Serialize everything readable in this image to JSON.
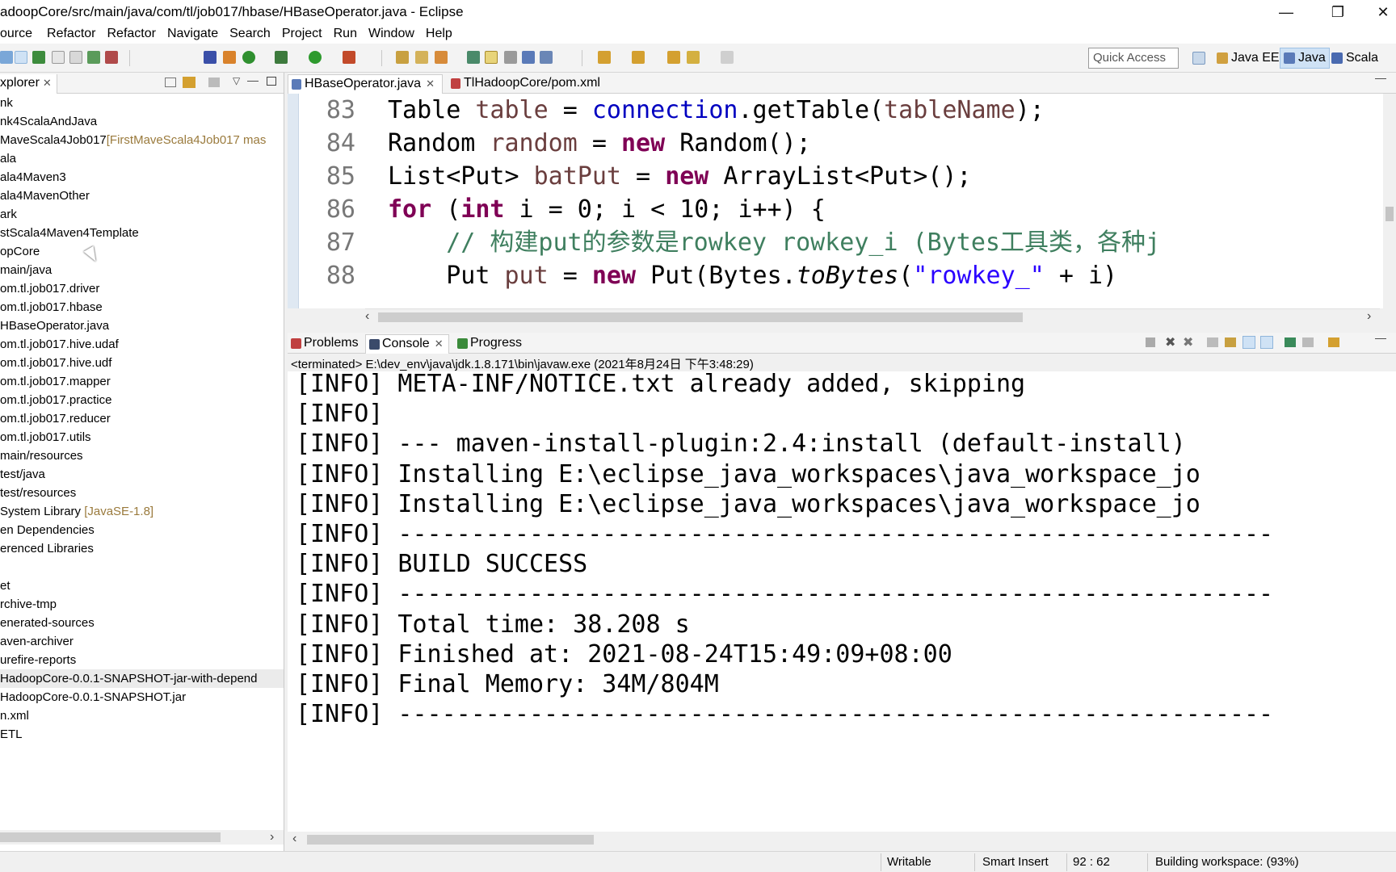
{
  "window": {
    "title": "adoopCore/src/main/java/com/tl/job017/hbase/HBaseOperator.java - Eclipse",
    "controls": [
      "—",
      "❐",
      "✕"
    ]
  },
  "menu": [
    "ource",
    "Refactor",
    "Refactor",
    "Navigate",
    "Search",
    "Project",
    "Run",
    "Window",
    "Help"
  ],
  "toolbar": {
    "quick_access": "Quick Access",
    "perspectives": [
      "Java EE",
      "Java",
      "Scala"
    ]
  },
  "explorer": {
    "tab": "xplorer",
    "items": [
      {
        "label": "nk",
        "dec": ""
      },
      {
        "label": "nk4ScalaAndJava",
        "dec": ""
      },
      {
        "label": "MaveScala4Job017",
        "dec": "[FirstMaveScala4Job017 mas"
      },
      {
        "label": "ala",
        "dec": ""
      },
      {
        "label": "ala4Maven3",
        "dec": ""
      },
      {
        "label": "ala4MavenOther",
        "dec": ""
      },
      {
        "label": "ark",
        "dec": ""
      },
      {
        "label": "stScala4Maven4Template",
        "dec": ""
      },
      {
        "label": "opCore",
        "dec": ""
      },
      {
        "label": "main/java",
        "dec": ""
      },
      {
        "label": "om.tl.job017.driver",
        "dec": ""
      },
      {
        "label": "om.tl.job017.hbase",
        "dec": ""
      },
      {
        "label": "  HBaseOperator.java",
        "dec": ""
      },
      {
        "label": "om.tl.job017.hive.udaf",
        "dec": ""
      },
      {
        "label": "om.tl.job017.hive.udf",
        "dec": ""
      },
      {
        "label": "om.tl.job017.mapper",
        "dec": ""
      },
      {
        "label": "om.tl.job017.practice",
        "dec": ""
      },
      {
        "label": "om.tl.job017.reducer",
        "dec": ""
      },
      {
        "label": "om.tl.job017.utils",
        "dec": ""
      },
      {
        "label": "main/resources",
        "dec": ""
      },
      {
        "label": "test/java",
        "dec": ""
      },
      {
        "label": "test/resources",
        "dec": ""
      },
      {
        "label": "System Library ",
        "dec": "[JavaSE-1.8]"
      },
      {
        "label": "en Dependencies",
        "dec": ""
      },
      {
        "label": "erenced Libraries",
        "dec": ""
      },
      {
        "label": "",
        "dec": ""
      },
      {
        "label": "et",
        "dec": ""
      },
      {
        "label": "rchive-tmp",
        "dec": ""
      },
      {
        "label": "enerated-sources",
        "dec": ""
      },
      {
        "label": "aven-archiver",
        "dec": ""
      },
      {
        "label": "urefire-reports",
        "dec": ""
      },
      {
        "label": "HadoopCore-0.0.1-SNAPSHOT-jar-with-depend",
        "dec": "",
        "selected": true
      },
      {
        "label": "HadoopCore-0.0.1-SNAPSHOT.jar",
        "dec": ""
      },
      {
        "label": "n.xml",
        "dec": ""
      },
      {
        "label": "ETL",
        "dec": ""
      }
    ]
  },
  "editor": {
    "tabs": [
      "HBaseOperator.java",
      "TlHadoopCore/pom.xml"
    ],
    "lines": [
      {
        "num": "83",
        "parts": [
          [
            "Table ",
            ""
          ],
          [
            "table",
            "var"
          ],
          [
            " = ",
            ""
          ],
          [
            "connection",
            "fld"
          ],
          [
            ".getTable(",
            ""
          ],
          [
            "tableName",
            "var"
          ],
          [
            ");",
            ""
          ]
        ]
      },
      {
        "num": "84",
        "parts": [
          [
            "Random ",
            ""
          ],
          [
            "random",
            "var"
          ],
          [
            " = ",
            ""
          ],
          [
            "new",
            "kw"
          ],
          [
            " Random();",
            ""
          ]
        ]
      },
      {
        "num": "85",
        "parts": [
          [
            "List<Put> ",
            ""
          ],
          [
            "batPut",
            "var"
          ],
          [
            " = ",
            ""
          ],
          [
            "new",
            "kw"
          ],
          [
            " ArrayList<Put>();",
            ""
          ]
        ]
      },
      {
        "num": "86",
        "parts": [
          [
            "for",
            "kw"
          ],
          [
            " (",
            ""
          ],
          [
            "int",
            "kw"
          ],
          [
            " i = 0; i < 10; i++) {",
            ""
          ]
        ]
      },
      {
        "num": "87",
        "parts": [
          [
            "    // 构建put的参数是rowkey rowkey_i (Bytes工具类，各种j",
            "cmt"
          ]
        ]
      },
      {
        "num": "88",
        "parts": [
          [
            "    Put ",
            ""
          ],
          [
            "put",
            "var"
          ],
          [
            " = ",
            ""
          ],
          [
            "new",
            "kw"
          ],
          [
            " Put(Bytes.",
            ""
          ],
          [
            "toBytes",
            "ita"
          ],
          [
            "(",
            ""
          ],
          [
            "\"rowkey_\"",
            "str"
          ],
          [
            " + i)",
            ""
          ]
        ]
      }
    ]
  },
  "console": {
    "tabs": [
      "Problems",
      "Console",
      "Progress"
    ],
    "terminated": "<terminated> E:\\dev_env\\java\\jdk.1.8.171\\bin\\javaw.exe (2021年8月24日 下午3:48:29)",
    "lines": [
      "[INFO] META-INF/NOTICE.txt already added, skipping",
      "[INFO]",
      "[INFO] --- maven-install-plugin:2.4:install (default-install) ",
      "[INFO] Installing E:\\eclipse_java_workspaces\\java_workspace_jo",
      "[INFO] Installing E:\\eclipse_java_workspaces\\java_workspace_jo",
      "[INFO] ------------------------------------------------------------",
      "[INFO] BUILD SUCCESS",
      "[INFO] ------------------------------------------------------------",
      "[INFO] Total time: 38.208 s",
      "[INFO] Finished at: 2021-08-24T15:49:09+08:00",
      "[INFO] Final Memory: 34M/804M",
      "[INFO] ------------------------------------------------------------"
    ]
  },
  "status": {
    "writable": "Writable",
    "insert": "Smart Insert",
    "position": "92 : 62",
    "task": "Building workspace: (93%)"
  },
  "colors": {
    "keyword": "#7f0055",
    "field": "#0000c0",
    "comment": "#3f7f5f",
    "string": "#2a00ff",
    "active_perspective": "#cfe2f5"
  }
}
